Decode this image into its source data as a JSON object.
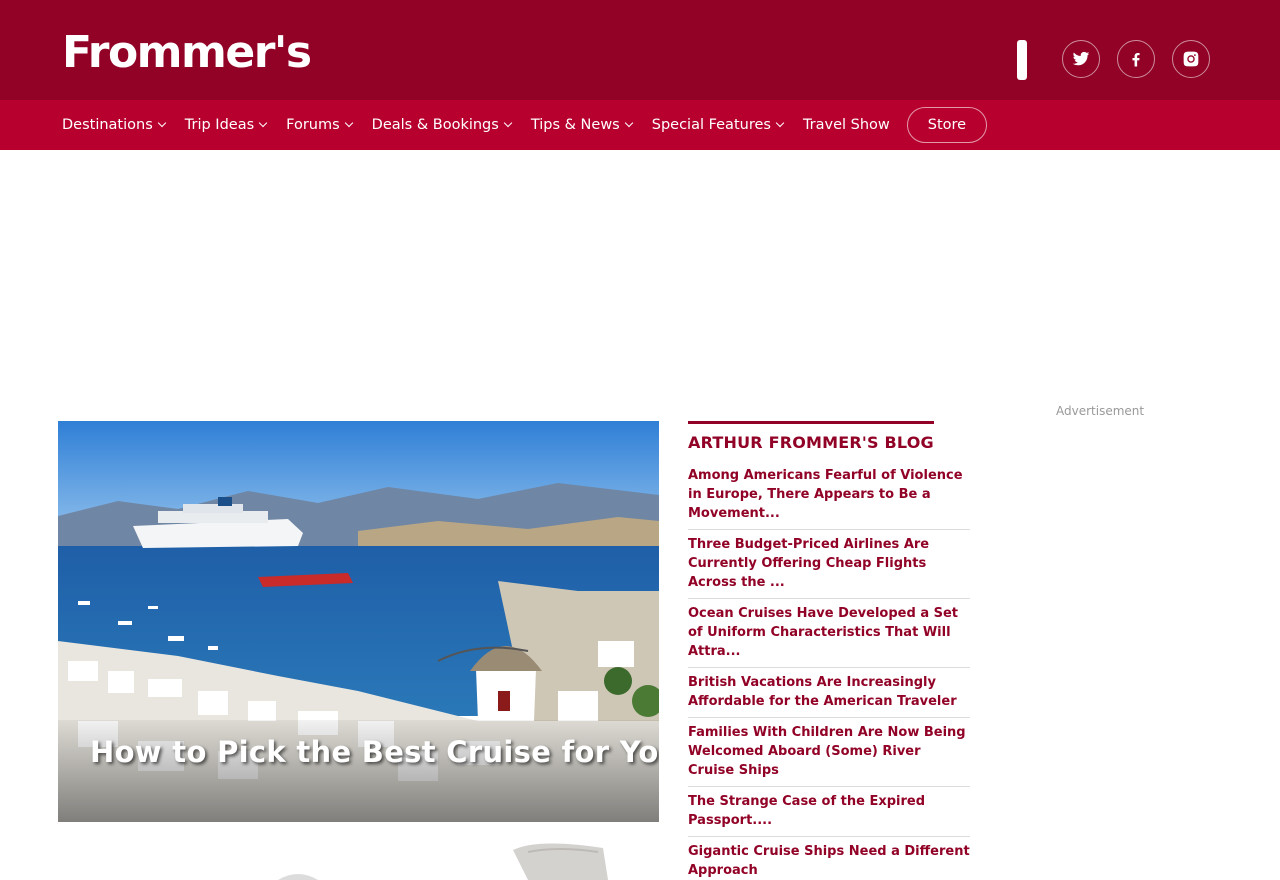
{
  "brand": {
    "logo_text": "Frommer's",
    "primary_color": "#910226",
    "nav_color": "#b8002f"
  },
  "social": [
    {
      "name": "twitter",
      "icon": "twitter-icon"
    },
    {
      "name": "facebook",
      "icon": "facebook-icon"
    },
    {
      "name": "instagram",
      "icon": "instagram-icon"
    }
  ],
  "nav": {
    "items": [
      "Destinations",
      "Trip Ideas",
      "Forums",
      "Deals & Bookings",
      "Tips & News",
      "Special Features",
      "Travel Show"
    ],
    "store_label": "Store"
  },
  "hero": {
    "title": "How to Pick the Best Cruise for You"
  },
  "blog": {
    "heading": "ARTHUR FROMMER'S BLOG",
    "items": [
      "Among Americans Fearful of Violence in Europe, There Appears to Be a Movement...",
      "Three Budget-Priced Airlines Are Currently Offering Cheap Flights Across the ...",
      "Ocean Cruises Have Developed a Set of Uniform Characteristics That Will Attra...",
      "British Vacations Are Increasingly Affordable for the American Traveler",
      "Families With Children Are Now Being Welcomed Aboard (Some) River Cruise Ships",
      "The Strange Case of the Expired Passport....",
      "Gigantic Cruise Ships Need a Different Approach"
    ]
  },
  "ad": {
    "label": "Advertisement"
  }
}
